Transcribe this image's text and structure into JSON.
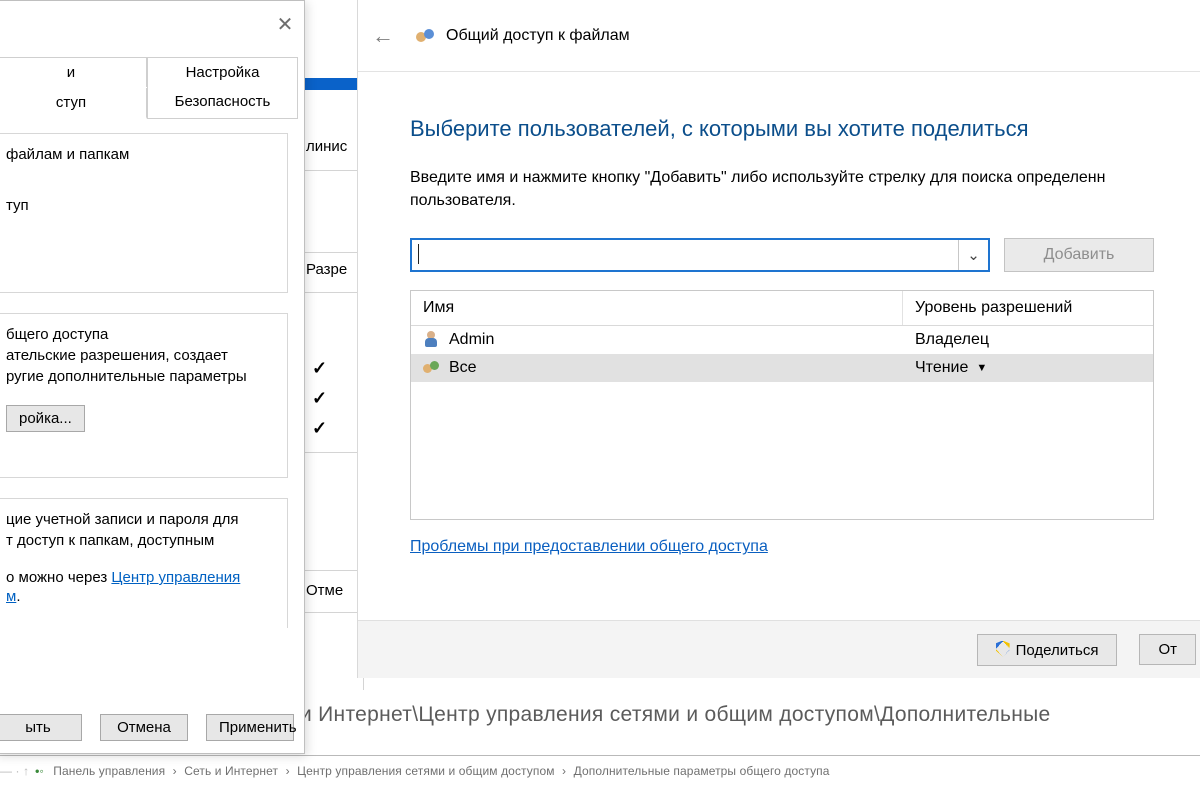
{
  "bg": {
    "path_fragment": "и Интернет\\Центр управления сетями и общим доступом\\Дополнительные",
    "crumbs": [
      "Панель управления",
      "Сеть и Интернет",
      "Центр управления сетями и общим доступом",
      "Дополнительные параметры общего доступа"
    ]
  },
  "prop": {
    "close": "✕",
    "tabs": {
      "general_partial": "и",
      "settings": "Настройка",
      "access_partial": "ступ",
      "security": "Безопасность"
    },
    "share_group": {
      "line1": "файлам и папкам",
      "line2": "туп"
    },
    "perm_col": "Разре",
    "adv_group": {
      "l1": "бщего доступа",
      "l2": "ательские разрешения, создает",
      "l3": "ругие дополнительные параметры",
      "btn": "ройка..."
    },
    "pwd_group": {
      "l1": "цие учетной записи и пароля для",
      "l2": "т доступ к папкам, доступным",
      "l3_prefix": "о можно через ",
      "l3_link": "Центр управления",
      "l4_link": "м"
    },
    "buttons": {
      "close_partial": "ыть",
      "cancel": "Отмена",
      "apply": "Применить"
    }
  },
  "mid": {
    "label_admin_partial": "линис",
    "cancel_partial": "Отме",
    "checks": true
  },
  "share": {
    "header": "Общий доступ к файлам",
    "title": "Выберите пользователей, с которыми вы хотите поделиться",
    "desc": "Введите имя и нажмите кнопку \"Добавить\" либо используйте стрелку для поиска определенн пользователя.",
    "add": "Добавить",
    "combo_value": "",
    "table": {
      "col_name": "Имя",
      "col_perm": "Уровень разрешений",
      "rows": [
        {
          "name": "Admin",
          "perm": "Владелец",
          "icon": "user",
          "selected": false,
          "dropdown": false
        },
        {
          "name": "Все",
          "perm": "Чтение",
          "icon": "group",
          "selected": true,
          "dropdown": true
        }
      ]
    },
    "help_link": "Проблемы при предоставлении общего доступа",
    "footer": {
      "share_btn": "Поделиться",
      "cancel_partial": "От"
    }
  }
}
